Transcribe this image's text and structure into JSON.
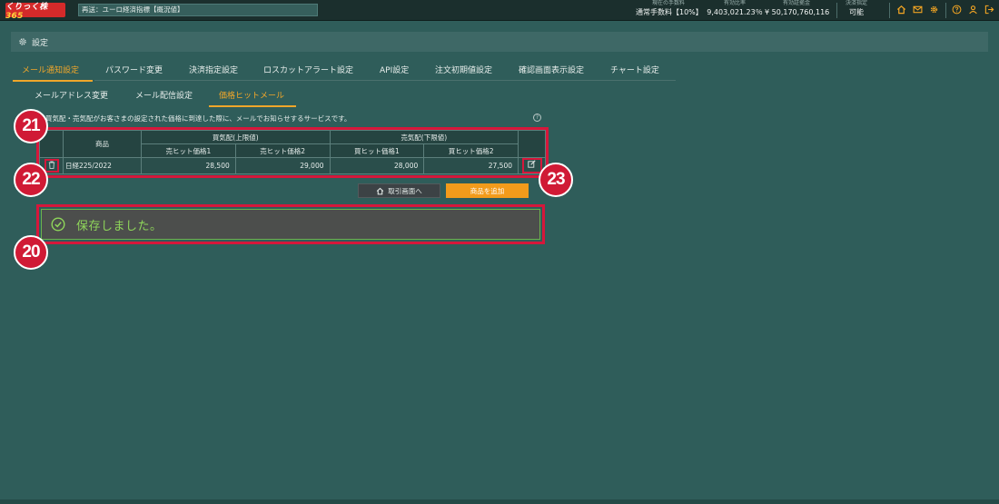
{
  "topbar": {
    "logo_text": "くりっく株",
    "logo_num": "365",
    "ticker": "再送：ユーロ経済指標【概況値】",
    "stats": [
      {
        "label": "現在の手数料",
        "value": "通常手数料【10%】"
      },
      {
        "label": "有効比率",
        "value": "9,403,021.23％"
      },
      {
        "label": "有効証拠金",
        "value": "¥ 50,170,760,116"
      },
      {
        "label": "決済指定",
        "value": "可能"
      }
    ],
    "icons": [
      "home-icon",
      "mail-icon",
      "gear-icon",
      "help-icon",
      "user-icon",
      "logout-icon"
    ]
  },
  "settings": {
    "title": "設定"
  },
  "tabs_main": [
    {
      "label": "メール通知設定",
      "active": true
    },
    {
      "label": "パスワード変更",
      "active": false
    },
    {
      "label": "決済指定設定",
      "active": false
    },
    {
      "label": "ロスカットアラート設定",
      "active": false
    },
    {
      "label": "API設定",
      "active": false
    },
    {
      "label": "注文初期値設定",
      "active": false
    },
    {
      "label": "確認画面表示設定",
      "active": false
    },
    {
      "label": "チャート設定",
      "active": false
    }
  ],
  "tabs_sub": [
    {
      "label": "メールアドレス変更",
      "active": false
    },
    {
      "label": "メール配信設定",
      "active": false
    },
    {
      "label": "価格ヒットメール",
      "active": true
    }
  ],
  "description": "買気配・売気配がお客さまの設定された価格に到達した際に、メールでお知らせするサービスです。",
  "table": {
    "col_product": "商品",
    "group_buy": "買気配(上限値)",
    "group_sell": "売気配(下限値)",
    "sub_headers": [
      "売ヒット価格1",
      "売ヒット価格2",
      "買ヒット価格1",
      "買ヒット価格2"
    ],
    "rows": [
      {
        "product": "日経225/2022",
        "v1": "28,500",
        "v2": "29,000",
        "v3": "28,000",
        "v4": "27,500"
      }
    ]
  },
  "buttons": {
    "to_trading": "取引画面へ",
    "add_product": "商品を追加"
  },
  "saved_message": "保存しました。",
  "callouts": [
    "20",
    "21",
    "22",
    "23"
  ],
  "colors": {
    "accent": "#f0a62a",
    "callout": "#d01a35",
    "success": "#8fd65a",
    "background": "#2f5d5a"
  }
}
